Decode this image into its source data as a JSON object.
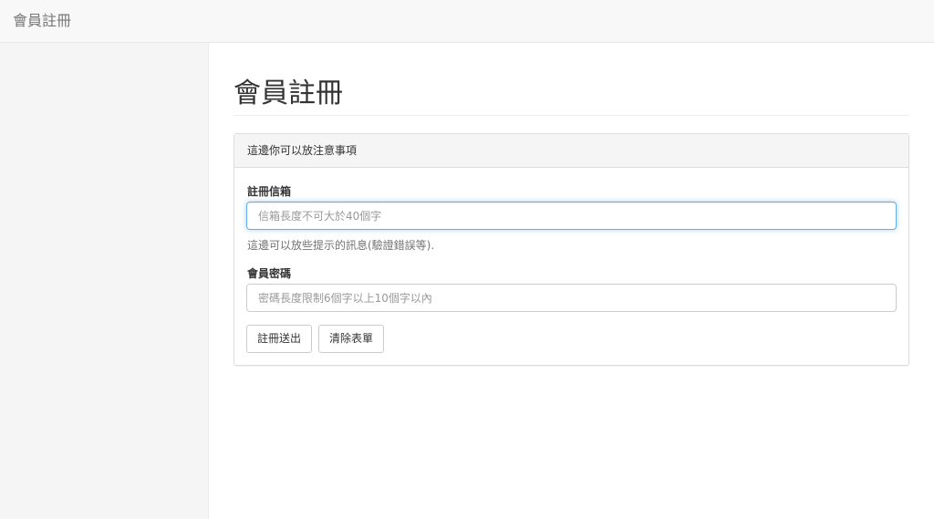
{
  "navbar": {
    "brand": "會員註冊"
  },
  "main": {
    "page_title": "會員註冊",
    "panel": {
      "heading": "這邊你可以放注意事項",
      "email": {
        "label": "註冊信箱",
        "placeholder": "信箱長度不可大於40個字",
        "value": "",
        "help": "這邊可以放些提示的訊息(驗證錯誤等)."
      },
      "password": {
        "label": "會員密碼",
        "placeholder": "密碼長度限制6個字以上10個字以內",
        "value": ""
      },
      "buttons": {
        "submit": "註冊送出",
        "reset": "清除表單"
      }
    }
  },
  "colors": {
    "focus_border": "#66afe9",
    "navbar_bg": "#f8f8f8",
    "sidebar_bg": "#f5f5f5"
  }
}
